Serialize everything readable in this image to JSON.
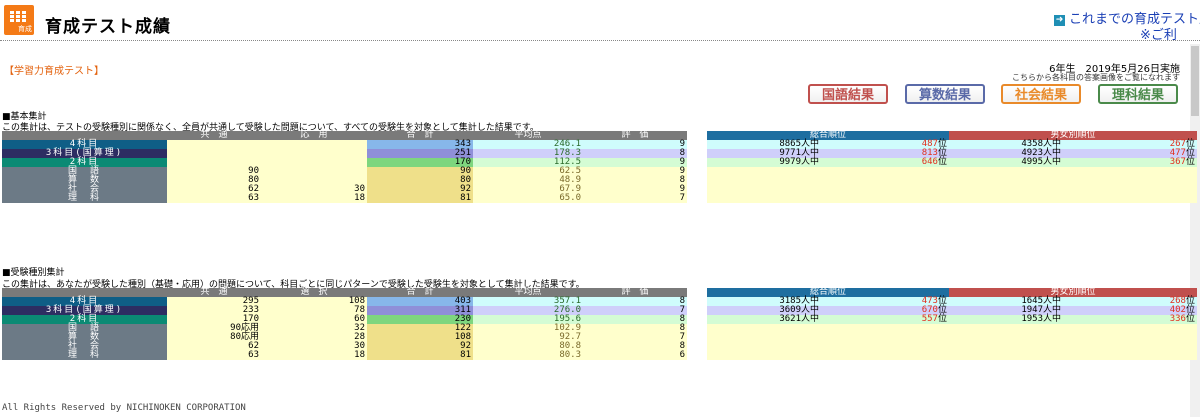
{
  "header": {
    "title": "育成テスト成績",
    "logo_label": "育成",
    "link": "これまでの育成テスト成",
    "note": "※ご利"
  },
  "section_label": "【学習力育成テスト】",
  "exam": {
    "grade": "6年生",
    "date": "2019年5月26日実施",
    "note": "こちらから各科目の答案画像をご覧になれます"
  },
  "result_buttons": [
    {
      "label": "国語結果",
      "color": "#c0504d"
    },
    {
      "label": "算数結果",
      "color": "#5a6aa8"
    },
    {
      "label": "社会結果",
      "color": "#e98a2a"
    },
    {
      "label": "理科結果",
      "color": "#4a8a4a"
    }
  ],
  "basic": {
    "title": "■基本集計",
    "desc": "この集計は、テストの受験種別に関係なく、全員が共通して受験した問題について、すべての受験生を対象として集計した結果です。",
    "headers": [
      "共　通",
      "応　用",
      "合　計",
      "平均点",
      "評　価"
    ],
    "rank_headers": [
      "総合順位",
      "男女別順位"
    ],
    "rows": [
      {
        "label": "4科目",
        "common": "",
        "applied": "",
        "total": "343",
        "avg": "246.1",
        "eval": "9",
        "rank": "8865人中",
        "rank_pos": "487",
        "rank_unit": "位",
        "grank": "4358人中",
        "grank_pos": "267",
        "grank_unit": "位"
      },
      {
        "label": "3科目(国算理)",
        "common": "",
        "applied": "",
        "total": "251",
        "avg": "178.3",
        "eval": "8",
        "rank": "9771人中",
        "rank_pos": "813",
        "rank_unit": "位",
        "grank": "4923人中",
        "grank_pos": "477",
        "grank_unit": "位"
      },
      {
        "label": "2科目",
        "common": "",
        "applied": "",
        "total": "170",
        "avg": "112.5",
        "eval": "9",
        "rank": "9979人中",
        "rank_pos": "646",
        "rank_unit": "位",
        "grank": "4995人中",
        "grank_pos": "367",
        "grank_unit": "位"
      },
      {
        "label": "国　語",
        "common": "90",
        "applied": "",
        "total": "90",
        "avg": "62.5",
        "eval": "9"
      },
      {
        "label": "算　数",
        "common": "80",
        "applied": "",
        "total": "80",
        "avg": "48.9",
        "eval": "8"
      },
      {
        "label": "社　会",
        "common": "62",
        "applied": "30",
        "total": "92",
        "avg": "67.9",
        "eval": "9"
      },
      {
        "label": "理　科",
        "common": "63",
        "applied": "18",
        "total": "81",
        "avg": "65.0",
        "eval": "7"
      }
    ]
  },
  "type": {
    "title": "■受験種別集計",
    "desc": "この集計は、あなたが受験した種別（基礎・応用）の問題について、科目ごとに同じパターンで受験した受験生を対象として集計した結果です。",
    "headers": [
      "共　通",
      "選　択",
      "合　計",
      "平均点",
      "評　価"
    ],
    "rank_headers": [
      "総合順位",
      "男女別順位"
    ],
    "rows": [
      {
        "label": "4科目",
        "common": "295",
        "applied": "108",
        "total": "403",
        "avg": "357.1",
        "eval": "8",
        "rank": "3185人中",
        "rank_pos": "473",
        "rank_unit": "位",
        "grank": "1645人中",
        "grank_pos": "268",
        "grank_unit": "位"
      },
      {
        "label": "3科目(国算理)",
        "common": "233",
        "applied": "78",
        "total": "311",
        "avg": "276.0",
        "eval": "7",
        "rank": "3609人中",
        "rank_pos": "670",
        "rank_unit": "位",
        "grank": "1947人中",
        "grank_pos": "402",
        "grank_unit": "位"
      },
      {
        "label": "2科目",
        "common": "170",
        "applied": "60",
        "total": "230",
        "avg": "195.6",
        "eval": "8",
        "rank": "3621人中",
        "rank_pos": "557",
        "rank_unit": "位",
        "grank": "1953人中",
        "grank_pos": "336",
        "grank_unit": "位"
      },
      {
        "label": "国　語",
        "common": "90応用",
        "applied": "32",
        "total": "122",
        "avg": "102.9",
        "eval": "8"
      },
      {
        "label": "算　数",
        "common": "80応用",
        "applied": "28",
        "total": "108",
        "avg": "92.7",
        "eval": "7"
      },
      {
        "label": "社　会",
        "common": "62",
        "applied": "30",
        "total": "92",
        "avg": "80.8",
        "eval": "8"
      },
      {
        "label": "理　科",
        "common": "63",
        "applied": "18",
        "total": "81",
        "avg": "80.3",
        "eval": "6"
      }
    ]
  },
  "footer": "All Rights Reserved by NICHINOKEN CORPORATION"
}
